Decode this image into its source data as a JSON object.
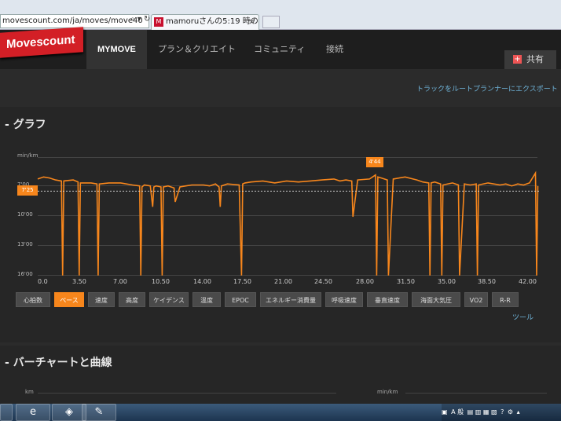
{
  "browser": {
    "address": "movescount.com/ja/moves/move40",
    "tab_title": "mamoruさんの5:19 時の..."
  },
  "header": {
    "logo": "Movescount",
    "nav": [
      "MYMOVE",
      "プラン＆クリエイト",
      "コミュニティ",
      "接続"
    ],
    "share_label": "共有"
  },
  "export_link": "トラックをルートプランナーにエクスポート",
  "graph_panel": {
    "title": "グラフ",
    "unit": "min/km",
    "current_marker": "7'25",
    "peak_marker": "4'44",
    "y_ticks": [
      "7'00",
      "10'00",
      "13'00",
      "16'00"
    ],
    "x_ticks": [
      "0.0",
      "3.50",
      "7.00",
      "10.50",
      "14.00",
      "17.50",
      "21.00",
      "24.50",
      "28.00",
      "31.50",
      "35.00",
      "38.50",
      "42.00"
    ],
    "metric_buttons": [
      "心拍数",
      "ペース",
      "速度",
      "高度",
      "ケイデンス",
      "温度",
      "EPOC",
      "エネルギー消費量",
      "呼吸速度",
      "垂直速度",
      "海面大気圧",
      "VO2",
      "R-R"
    ],
    "active_metric": "ペース",
    "tools_link": "ツール"
  },
  "bar_panel": {
    "title": "バーチャートと曲線",
    "unit_left": "km",
    "unit_right": "min/km"
  },
  "colors": {
    "accent": "#f7861c",
    "brand": "#d31f26",
    "link": "#6fb3d8"
  },
  "chart_data": {
    "type": "line",
    "xlabel": "",
    "ylabel": "min/km",
    "y_inverted": true,
    "xlim": [
      0,
      42.3
    ],
    "ylim": [
      4.0,
      16.0
    ],
    "series": [
      {
        "x": [
          0,
          0.5,
          1.0,
          1.5,
          2.0,
          2.1,
          2.2,
          3.0,
          3.4,
          3.5,
          3.6,
          4.5,
          5.0,
          5.1,
          5.2,
          6.0,
          7.0,
          8.0,
          8.6,
          8.7,
          8.8,
          9.0,
          9.5,
          9.7,
          9.8,
          10.0,
          10.4,
          10.5,
          10.6,
          11.0,
          11.5,
          11.6,
          12.0,
          12.5,
          13.0,
          14.0,
          14.5,
          15.0,
          15.3,
          15.4,
          15.5,
          16.0,
          17.0,
          17.2,
          17.3,
          17.5,
          18.0,
          19.0,
          20.0,
          21.0,
          22.0,
          23.0,
          24.0,
          25.0,
          25.5,
          26.0,
          26.5,
          26.6,
          27.0,
          28.0,
          28.5,
          28.6,
          28.7,
          29.0,
          29.5,
          29.6,
          30.0,
          31.0,
          32.0,
          32.5,
          33.0,
          33.1,
          33.2,
          33.5,
          34.0,
          34.1,
          34.2,
          35.0,
          35.5,
          35.6,
          36.0,
          36.5,
          37.0,
          37.1,
          37.2,
          38.0,
          39.0,
          39.5,
          40.0,
          40.5,
          41.0,
          41.5,
          42.0,
          42.1,
          42.2
        ],
        "values": [
          6.2,
          6.0,
          6.1,
          6.3,
          6.4,
          15.9,
          6.4,
          6.3,
          6.5,
          15.9,
          6.6,
          6.6,
          6.7,
          15.9,
          6.7,
          6.6,
          6.6,
          6.8,
          6.9,
          15.9,
          7.0,
          6.8,
          6.9,
          9.0,
          7.0,
          6.9,
          7.0,
          15.9,
          7.0,
          6.9,
          7.1,
          8.5,
          7.0,
          6.9,
          6.8,
          6.8,
          6.9,
          6.7,
          7.0,
          9.0,
          6.9,
          6.7,
          6.8,
          15.9,
          6.7,
          6.6,
          6.5,
          6.4,
          6.6,
          6.4,
          6.5,
          6.4,
          6.3,
          6.2,
          6.4,
          6.3,
          6.4,
          10.0,
          6.3,
          6.2,
          5.8,
          15.9,
          6.0,
          6.1,
          6.3,
          15.9,
          6.2,
          6.0,
          6.3,
          6.5,
          6.6,
          15.9,
          6.6,
          6.5,
          6.7,
          15.9,
          6.8,
          6.6,
          6.8,
          15.9,
          6.7,
          6.8,
          6.7,
          15.9,
          6.8,
          6.6,
          6.8,
          6.7,
          6.9,
          6.7,
          6.8,
          6.6,
          5.6,
          15.9,
          6.9
        ]
      }
    ],
    "reference_line": 7.42
  }
}
